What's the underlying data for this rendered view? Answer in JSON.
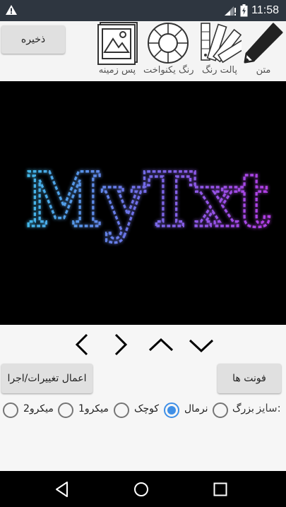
{
  "status": {
    "time": "11:58",
    "icons": [
      "warning-icon",
      "signal-icon",
      "battery-icon"
    ]
  },
  "toolbar": {
    "save_label": "ذخیره",
    "tools": [
      {
        "label": "متن",
        "icon": "pencil-icon"
      },
      {
        "label": "پالت رنگ",
        "icon": "swatches-icon"
      },
      {
        "label": "رنگ یکنواخت",
        "icon": "color-wheel-icon"
      },
      {
        "label": "پس زمینه",
        "icon": "image-icon"
      }
    ]
  },
  "canvas": {
    "preview_text": "MyTxt",
    "background": "#000000",
    "gradient": [
      "#41b8e8",
      "#6f6fe8",
      "#b33ee6"
    ]
  },
  "controls": {
    "arrows": [
      "left-arrow-icon",
      "right-arrow-icon",
      "up-arrow-icon",
      "down-arrow-icon"
    ],
    "apply_label": "اعمال تغییرات/اجرا",
    "fonts_label": "فونت ها",
    "size_label": "سایز:",
    "sizes": [
      {
        "label": "بزرگ",
        "selected": false
      },
      {
        "label": "نرمال",
        "selected": true
      },
      {
        "label": "کوچک",
        "selected": false
      },
      {
        "label": "میکرو1",
        "selected": false
      },
      {
        "label": "میکرو2",
        "selected": false
      }
    ]
  },
  "navbar": {
    "buttons": [
      "back-icon",
      "home-icon",
      "recents-icon"
    ]
  },
  "colors": {
    "accent": "#3f8fe6",
    "status_bar": "#2e3640"
  }
}
